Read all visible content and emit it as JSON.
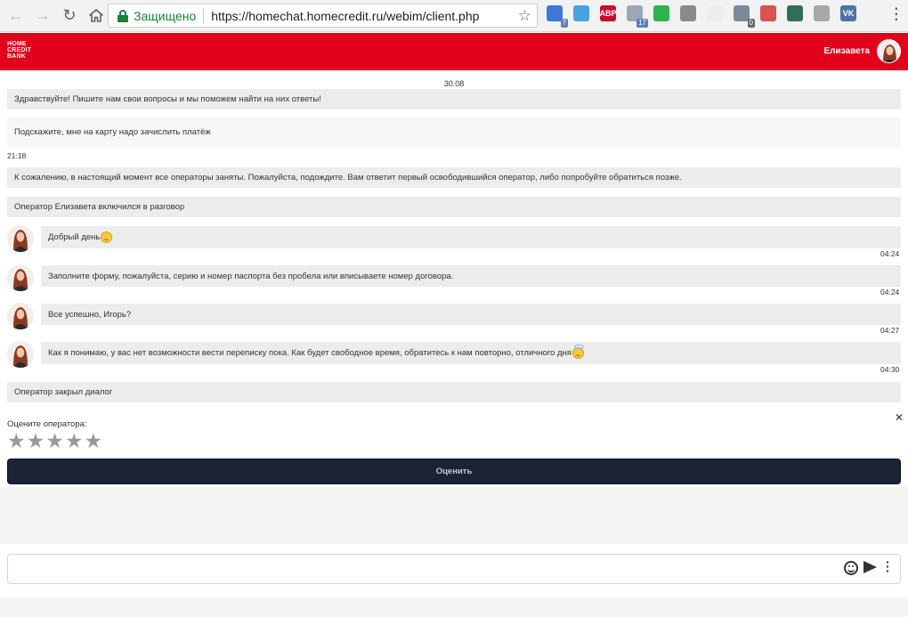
{
  "browser": {
    "secure_label": "Защищено",
    "url": "https://homechat.homecredit.ru/webim/client.php",
    "extensions": [
      {
        "name": "calendar-ext-icon",
        "color": "#3b78d8",
        "text": "",
        "badge": "7"
      },
      {
        "name": "weather-ext-icon",
        "color": "#4aa3df",
        "text": "",
        "badge": ""
      },
      {
        "name": "adblock-plus-icon",
        "color": "#c70d2c",
        "text": "ABP",
        "badge": ""
      },
      {
        "name": "cloud-ext-icon",
        "color": "#9aa8b5",
        "text": "",
        "badge": "17"
      },
      {
        "name": "pin-ext-icon",
        "color": "#2cb34a",
        "text": "",
        "badge": ""
      },
      {
        "name": "sphere-ext-icon",
        "color": "#8a8a8a",
        "text": "",
        "badge": ""
      },
      {
        "name": "search-ext-icon",
        "color": "#ededed",
        "text": "",
        "badge": ""
      },
      {
        "name": "tools-ext-icon",
        "color": "#7a8a99",
        "text": "",
        "badge": "0"
      },
      {
        "name": "gift-ext-icon",
        "color": "#d9534f",
        "text": "",
        "badge": ""
      },
      {
        "name": "shield-ext-icon",
        "color": "#2f6f58",
        "text": "",
        "badge": ""
      },
      {
        "name": "download-ext-icon",
        "color": "#a8a8a8",
        "text": "",
        "badge": ""
      },
      {
        "name": "vk-ext-icon",
        "color": "#4c75a3",
        "text": "VK",
        "badge": ""
      }
    ]
  },
  "header": {
    "logo_line1": "HOME",
    "logo_line2": "CREDIT",
    "logo_line3": "BANK",
    "operator_name": "Елизавета"
  },
  "chat": {
    "date": "30.08",
    "messages": [
      {
        "kind": "system",
        "text": "Здравствуйте! Пишите нам свои вопросы и мы поможем найти на них ответы!"
      },
      {
        "kind": "client",
        "text": "Подскажите, мне на карту надо зачислить платёж",
        "time": "21:18"
      },
      {
        "kind": "system",
        "text": "К сожалению, в настоящий момент все операторы заняты. Пожалуйста, подождите. Вам ответит первый освободившийся оператор, либо попробуйте обратиться позже."
      },
      {
        "kind": "system",
        "text": "Оператор Елизавета включился в разговор"
      },
      {
        "kind": "operator",
        "text": "Добрый день",
        "emoji": "smile",
        "time": "04:24"
      },
      {
        "kind": "operator",
        "text": "Заполните форму, пожалуйста, серию и номер паспорта без пробела или вписываете номер договора.",
        "time": "04:24"
      },
      {
        "kind": "operator",
        "text": "Все успешно, Игорь?",
        "time": "04:27"
      },
      {
        "kind": "operator",
        "text": "Как я понимаю, у вас нет возможности вести переписку пока. Как будет свободное время, обратитесь к нам повторно, отличного дня",
        "emoji": "halo",
        "time": "04:30"
      },
      {
        "kind": "system",
        "text": "Оператор закрыл диалог"
      }
    ]
  },
  "rating": {
    "label": "Оцените оператора:",
    "stars_max": 5,
    "stars_selected": 0,
    "submit_label": "Оценить"
  },
  "composer": {
    "value": "",
    "placeholder": ""
  }
}
